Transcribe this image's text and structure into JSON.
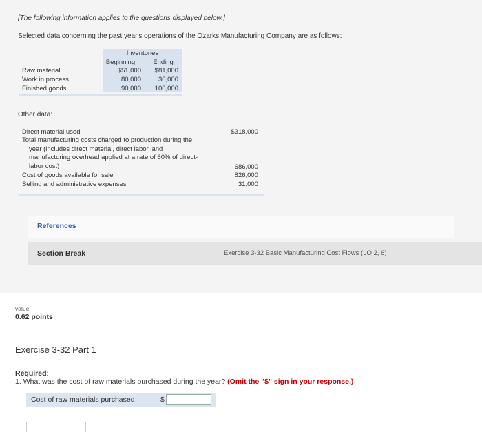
{
  "intro": {
    "italic_note": "[The following information applies to the questions displayed below.]",
    "description": "Selected data concerning the past year's operations of the Ozarks Manufacturing Company are as follows:"
  },
  "inventories": {
    "header": "Inventories",
    "col_beginning": "Beginning",
    "col_ending": "Ending",
    "rows": [
      {
        "label": "Raw material",
        "beginning": "$51,000",
        "ending": "$81,000"
      },
      {
        "label": "Work in process",
        "beginning": "80,000",
        "ending": "30,000"
      },
      {
        "label": "Finished goods",
        "beginning": "90,000",
        "ending": "100,000"
      }
    ]
  },
  "other_data": {
    "label": "Other data:",
    "rows": [
      {
        "lines": [
          "Direct material used"
        ],
        "value": "$318,000"
      },
      {
        "lines": [
          "Total manufacturing costs charged to production during the",
          "year (includes direct material, direct labor, and",
          "manufacturing overhead applied at a rate of 60% of direct-",
          "labor cost)"
        ],
        "value": "686,000"
      },
      {
        "lines": [
          "Cost of goods available for sale"
        ],
        "value": "826,000"
      },
      {
        "lines": [
          "Selling and administrative expenses"
        ],
        "value": "31,000"
      }
    ]
  },
  "references": {
    "label": "References"
  },
  "section": {
    "break_label": "Section Break",
    "exercise_ref": "Exercise 3-32 Basic Manufacturing Cost Flows (LO 2, 6)"
  },
  "score": {
    "value_label": "value:",
    "points": "0.62 points"
  },
  "question": {
    "part_title": "Exercise 3-32 Part 1",
    "required_label": "Required:",
    "number": "1.",
    "text": "What was the cost of raw materials purchased during the year?",
    "instruction": "(Omit the \"$\" sign in your response.)",
    "answer_label": "Cost of raw materials purchased",
    "currency_symbol": "$",
    "answer_value": ""
  }
}
